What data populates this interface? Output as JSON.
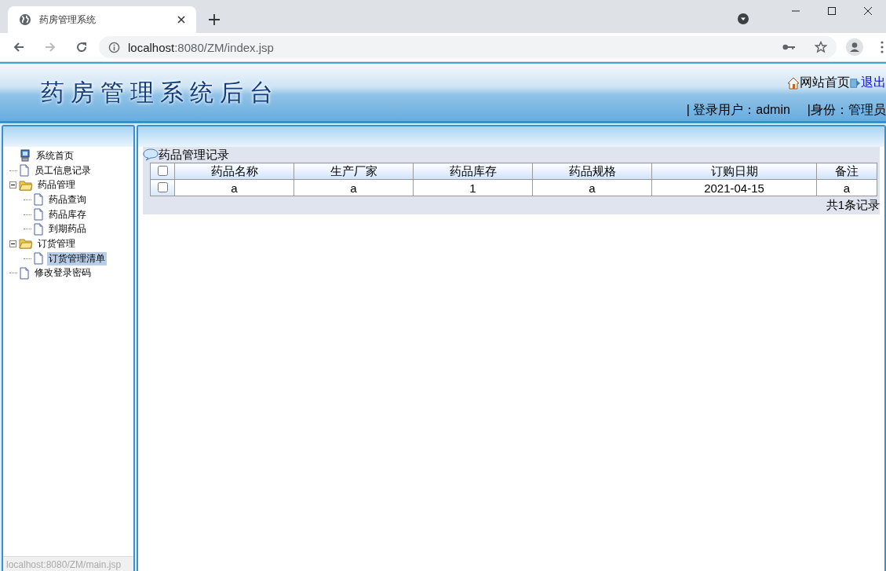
{
  "browser": {
    "tab_title": "药房管理系统",
    "url_host": "localhost",
    "url_rest": ":8080/ZM/index.jsp"
  },
  "header": {
    "title": "药房管理系统后台",
    "home_link": "网站首页",
    "logout_link": "退出",
    "user_label": "| 登录用户：admin",
    "role_label": "|身份：管理员"
  },
  "sidebar": {
    "items": [
      {
        "label": "系统首页",
        "kind": "computer",
        "selected": false
      },
      {
        "label": "员工信息记录",
        "kind": "page",
        "selected": false
      },
      {
        "label": "药品管理",
        "kind": "folder",
        "selected": false,
        "expanded": true,
        "children": [
          {
            "label": "药品查询",
            "kind": "page",
            "selected": false
          },
          {
            "label": "药品库存",
            "kind": "page",
            "selected": false
          },
          {
            "label": "到期药品",
            "kind": "page",
            "selected": false
          }
        ]
      },
      {
        "label": "订货管理",
        "kind": "folder",
        "selected": false,
        "expanded": true,
        "children": [
          {
            "label": "订货管理清单",
            "kind": "page",
            "selected": true
          }
        ]
      },
      {
        "label": "修改登录密码",
        "kind": "page",
        "selected": false
      }
    ]
  },
  "panel": {
    "title": "药品管理记录",
    "table": {
      "header_checked": false,
      "columns": [
        "药品名称",
        "生产厂家",
        "药品库存",
        "药品规格",
        "订购日期",
        "备注"
      ],
      "rows": [
        {
          "checked": false,
          "cells": [
            "a",
            "a",
            "1",
            "a",
            "2021-04-15",
            "a"
          ]
        }
      ]
    },
    "footer": "共1条记录"
  },
  "status_bar": "localhost:8080/ZM/main.jsp"
}
